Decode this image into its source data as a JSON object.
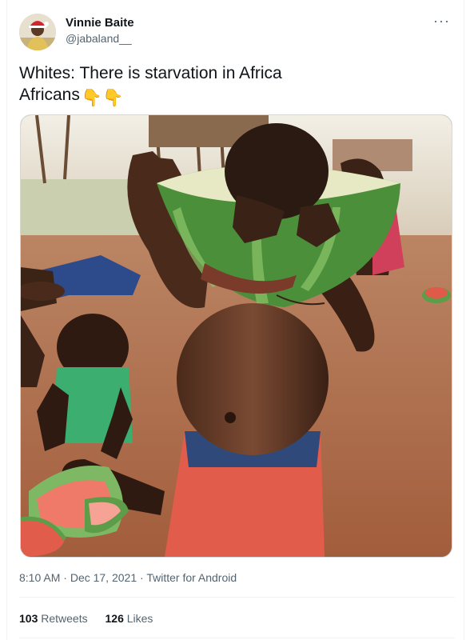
{
  "tweet": {
    "author_name": "Vinnie Baite",
    "author_handle": "@jabaland__",
    "text_line1": "Whites: There is starvation in Africa",
    "text_line2": "Africans",
    "emoji": "👇👇",
    "more_label": "···"
  },
  "meta": {
    "time": "8:10 AM",
    "separator": "·",
    "date": "Dec 17, 2021",
    "source": "Twitter for Android"
  },
  "stats": {
    "retweets_count": "103",
    "retweets_label": "Retweets",
    "likes_count": "126",
    "likes_label": "Likes"
  }
}
